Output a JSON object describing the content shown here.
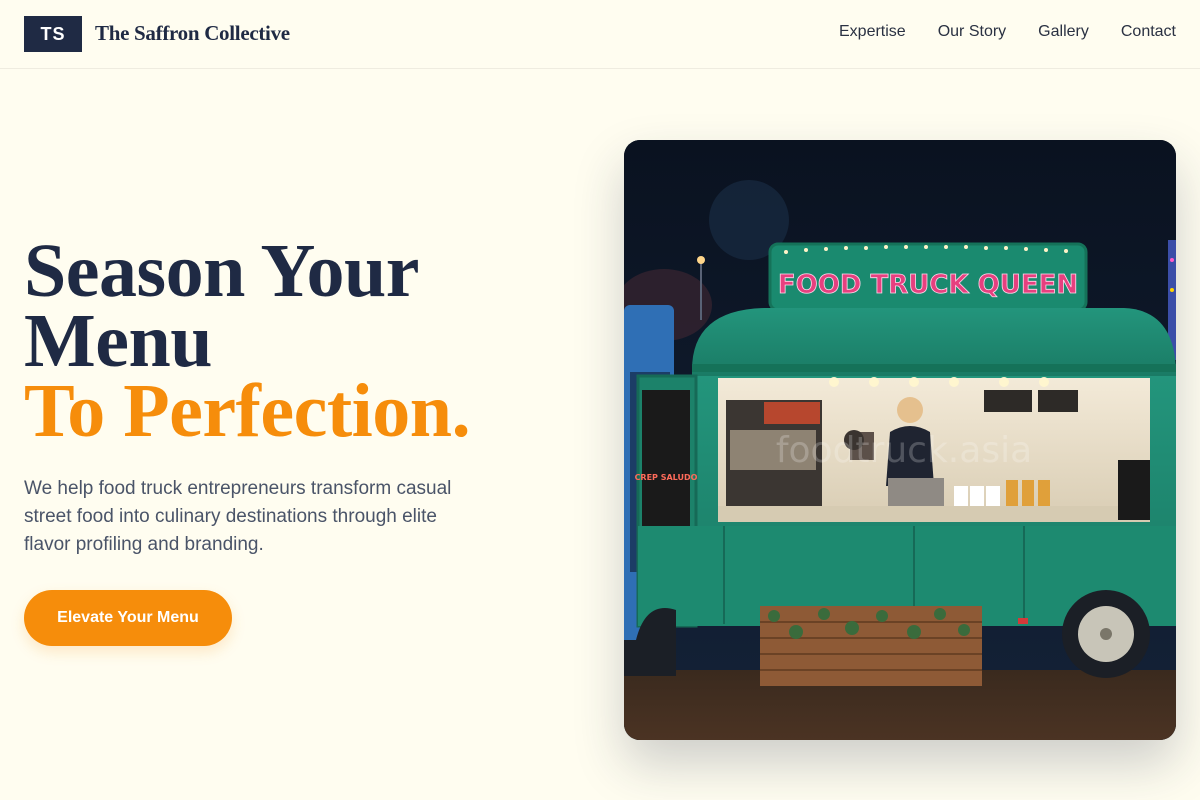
{
  "header": {
    "logo_initials": "TS",
    "brand_name": "The Saffron Collective",
    "nav": [
      "Expertise",
      "Our Story",
      "Gallery",
      "Contact"
    ]
  },
  "hero": {
    "title_line1": "Season Your",
    "title_line2": "Menu",
    "title_accent": "To Perfection.",
    "description": "We help food truck entrepreneurs transform casual street food into culinary destinations through elite flavor profiling and branding.",
    "cta_label": "Elevate Your Menu"
  },
  "image": {
    "sign_text": "FOOD TRUCK QUEEN",
    "watermark": "foodtruck.asia",
    "board_left": "CREP SALUDO"
  },
  "colors": {
    "navy": "#1f2a44",
    "accent": "#f68d0b",
    "background": "#fffdf0",
    "truck_teal": "#1f8a72"
  }
}
